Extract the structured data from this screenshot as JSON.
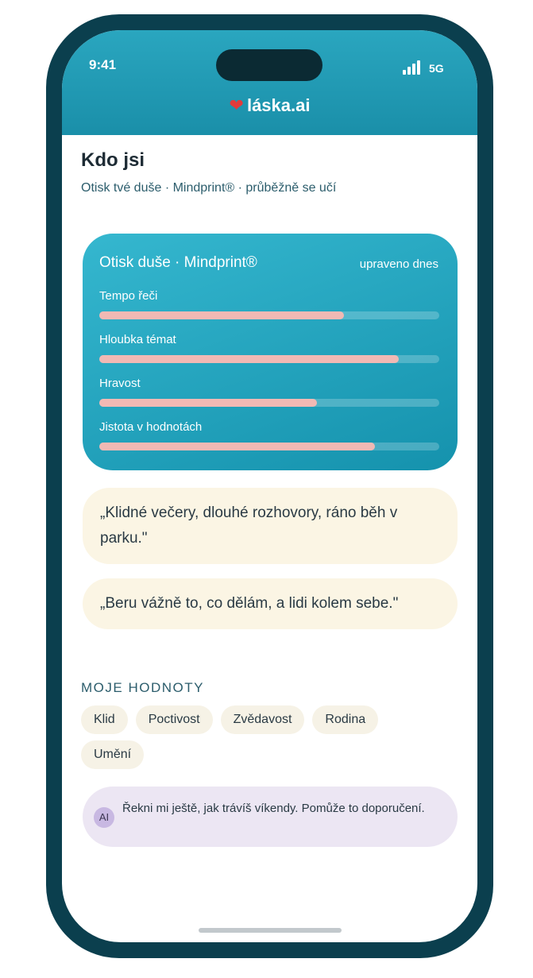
{
  "status": {
    "time": "9:41",
    "network": "5G"
  },
  "brand": {
    "name": "láska.ai",
    "icon": "heart-icon",
    "heart_color": "#e23b3b"
  },
  "page": {
    "title": "Kdo jsi",
    "subtitle": "Otisk tvé duše · Mindprint® · průběžně se učí"
  },
  "mindprint": {
    "title": "Otisk duše · Mindprint®",
    "updated": "upraveno dnes",
    "metrics": [
      {
        "label": "Tempo řeči",
        "value": 0.72
      },
      {
        "label": "Hloubka témat",
        "value": 0.88
      },
      {
        "label": "Hravost",
        "value": 0.64
      },
      {
        "label": "Jistota v hodnotách",
        "value": 0.81
      }
    ]
  },
  "quotes": [
    "„Klidné večery, dlouhé rozhovory, ráno běh v parku.\"",
    "„Beru vážně to, co dělám, a lidi kolem sebe.\""
  ],
  "values": {
    "heading": "MOJE HODNOTY",
    "items": [
      "Klid",
      "Poctivost",
      "Zvědavost",
      "Rodina",
      "Umění"
    ]
  },
  "ai_prompt": {
    "badge": "AI",
    "text": "Řekni mi ještě, jak trávíš víkendy. Pomůže to doporučení."
  },
  "colors": {
    "accent": "#1a8fa9",
    "frame": "#0b3f4e",
    "bar_fill": "#f1b9b4",
    "quote_bg": "#fbf5e4",
    "ai_bg": "#ece6f3"
  }
}
